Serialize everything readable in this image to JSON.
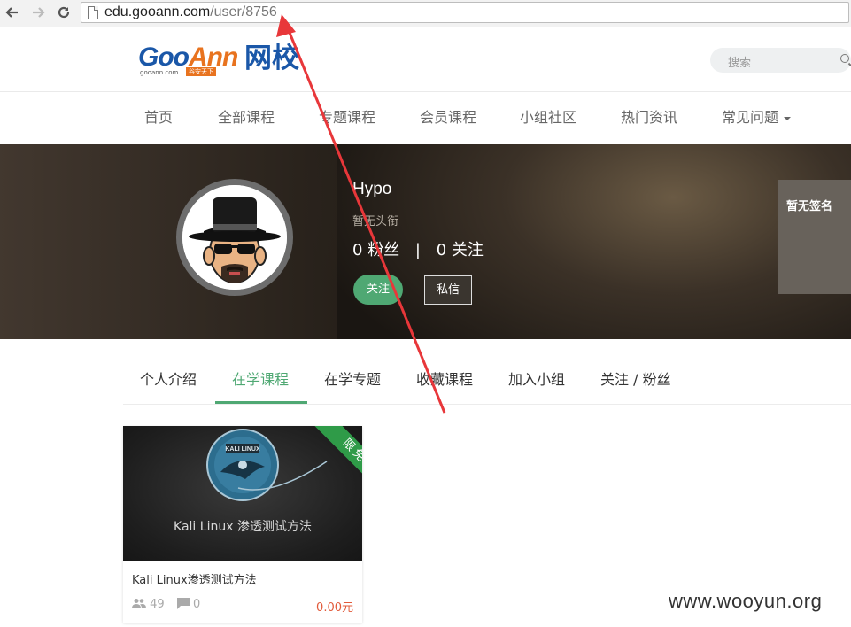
{
  "browser": {
    "back_icon": "arrow-left",
    "forward_icon": "arrow-right",
    "reload_icon": "reload",
    "url_host": "edu.gooann.com",
    "url_path": "/user/8756"
  },
  "header": {
    "logo": {
      "brand_goo": "Goo",
      "brand_ann": "Ann",
      "brand_cn": "网校",
      "domain": "gooann.com",
      "slogan": "谷安天下"
    },
    "search_placeholder": "搜索"
  },
  "nav": {
    "items": [
      "首页",
      "全部课程",
      "专题课程",
      "会员课程",
      "小组社区",
      "热门资讯",
      "常见问题"
    ]
  },
  "profile": {
    "name": "Hypo",
    "title": "暂无头衔",
    "fans_count": "0",
    "fans_label": "粉丝",
    "separator": "|",
    "following_count": "0",
    "following_label": "关注",
    "follow_button": "关注",
    "message_button": "私信",
    "signature": "暂无签名"
  },
  "tabs": {
    "items": [
      "个人介绍",
      "在学课程",
      "在学专题",
      "收藏课程",
      "加入小组",
      "关注 / 粉丝"
    ],
    "active": "在学课程"
  },
  "courses": [
    {
      "ribbon": "限免",
      "thumb_caption": "Kali Linux 渗透测试方法",
      "thumb_logo": "KALI LINUX",
      "title": "Kali Linux渗透测试方法",
      "students": "49",
      "comments": "0",
      "price": "0.00元"
    }
  ],
  "watermark": "www.wooyun.org",
  "colors": {
    "accent": "#4fa873",
    "annotation_arrow": "#e8373a",
    "price": "#e25a3a"
  }
}
